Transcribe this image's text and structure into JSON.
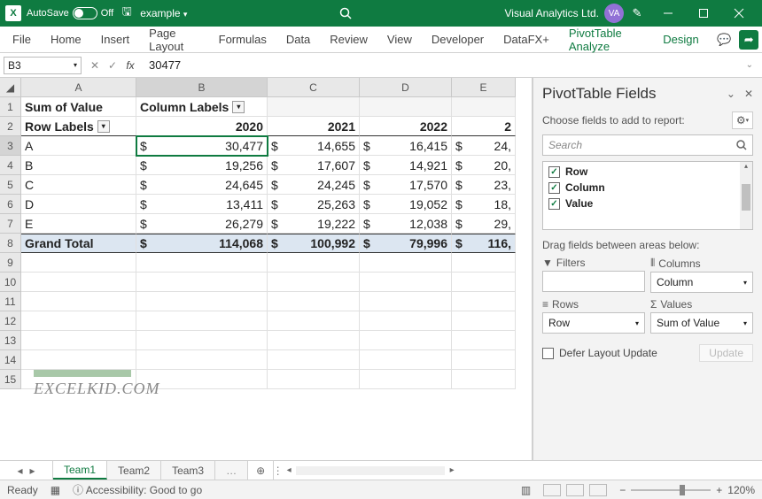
{
  "titlebar": {
    "autosave_label": "AutoSave",
    "autosave_state": "Off",
    "filename": "example",
    "account": "Visual Analytics Ltd.",
    "avatar_initials": "VA"
  },
  "ribbon": {
    "tabs": [
      "File",
      "Home",
      "Insert",
      "Page Layout",
      "Formulas",
      "Data",
      "Review",
      "View",
      "Developer",
      "DataFX+",
      "PivotTable Analyze",
      "Design"
    ]
  },
  "formulabar": {
    "namebox": "B3",
    "formula": "30477"
  },
  "grid": {
    "col_headers": [
      "A",
      "B",
      "C",
      "D",
      "E"
    ],
    "row_headers": [
      "1",
      "2",
      "3",
      "4",
      "5",
      "6",
      "7",
      "8",
      "9",
      "10",
      "11",
      "12",
      "13",
      "14",
      "15"
    ],
    "pivot_title": "Sum of Value",
    "column_labels_text": "Column Labels",
    "row_labels_text": "Row Labels",
    "year_cols": [
      "2020",
      "2021",
      "2022",
      "2"
    ],
    "rows": [
      {
        "label": "A",
        "vals": [
          "30,477",
          "14,655",
          "16,415",
          "24,"
        ]
      },
      {
        "label": "B",
        "vals": [
          "19,256",
          "17,607",
          "14,921",
          "20,"
        ]
      },
      {
        "label": "C",
        "vals": [
          "24,645",
          "24,245",
          "17,570",
          "23,"
        ]
      },
      {
        "label": "D",
        "vals": [
          "13,411",
          "25,263",
          "19,052",
          "18,"
        ]
      },
      {
        "label": "E",
        "vals": [
          "26,279",
          "19,222",
          "12,038",
          "29,"
        ]
      }
    ],
    "grand_total_label": "Grand Total",
    "grand_total_vals": [
      "114,068",
      "100,992",
      "79,996",
      "116,"
    ],
    "currency": "$",
    "active_cell": "B3",
    "watermark": "EXCELKID.COM"
  },
  "panel": {
    "title": "PivotTable Fields",
    "subtitle": "Choose fields to add to report:",
    "search_placeholder": "Search",
    "fields": [
      "Row",
      "Column",
      "Value"
    ],
    "drag_text": "Drag fields between areas below:",
    "areas": {
      "filters_label": "Filters",
      "columns_label": "Columns",
      "rows_label": "Rows",
      "values_label": "Values",
      "columns_value": "Column",
      "rows_value": "Row",
      "values_value": "Sum of Value"
    },
    "defer_label": "Defer Layout Update",
    "update_label": "Update"
  },
  "sheets": {
    "tabs": [
      "Team1",
      "Team2",
      "Team3"
    ],
    "active": 0
  },
  "status": {
    "ready": "Ready",
    "accessibility": "Accessibility: Good to go",
    "zoom": "120%"
  }
}
